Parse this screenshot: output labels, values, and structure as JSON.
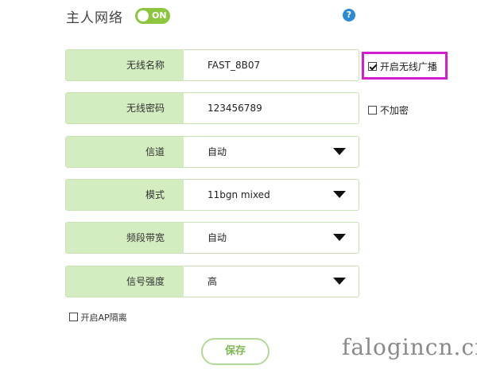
{
  "header": {
    "title": "主人网络",
    "toggle_label": "ON",
    "help_symbol": "?"
  },
  "form": {
    "fields": [
      {
        "label": "无线名称",
        "value": "FAST_8B07"
      },
      {
        "label": "无线密码",
        "value": "123456789"
      },
      {
        "label": "信道",
        "value": "自动"
      },
      {
        "label": "模式",
        "value": "11bgn mixed"
      },
      {
        "label": "频段带宽",
        "value": "自动"
      },
      {
        "label": "信号强度",
        "value": "高"
      }
    ]
  },
  "options": {
    "broadcast_label": "开启无线广播",
    "broadcast_checked": true,
    "no_encryption_label": "不加密",
    "no_encryption_checked": false,
    "ap_isolation_label": "开启AP隔离",
    "ap_isolation_checked": false
  },
  "save_label": "保存",
  "watermark": "falogincn.cn",
  "colors": {
    "accent_green": "#8cc63f",
    "label_bg": "#d3ecc0",
    "highlight": "#d21ed0",
    "help_blue": "#2a8ad6"
  }
}
